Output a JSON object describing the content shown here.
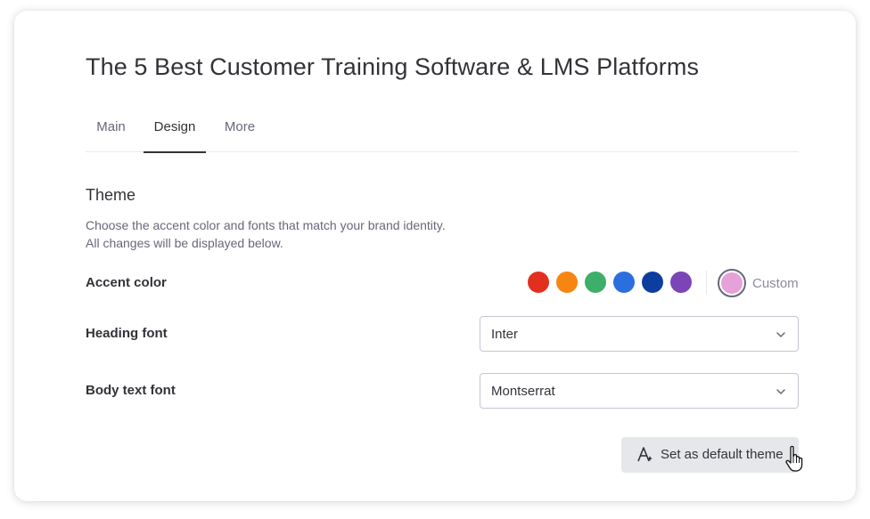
{
  "page": {
    "title": "The 5 Best Customer Training Software & LMS Platforms"
  },
  "tabs": [
    {
      "label": "Main",
      "active": false
    },
    {
      "label": "Design",
      "active": true
    },
    {
      "label": "More",
      "active": false
    }
  ],
  "theme": {
    "title": "Theme",
    "description_line1": "Choose the accent color and fonts that match your brand identity.",
    "description_line2": "All changes will be displayed below."
  },
  "accent": {
    "label": "Accent color",
    "swatches": [
      "#e2301f",
      "#f68512",
      "#3daf6a",
      "#2b6fde",
      "#0d3d9f",
      "#7b45b8"
    ],
    "custom_color": "#e6a1d8",
    "custom_label": "Custom",
    "selected": "custom"
  },
  "heading_font": {
    "label": "Heading font",
    "value": "Inter"
  },
  "body_font": {
    "label": "Body text font",
    "value": "Montserrat"
  },
  "actions": {
    "set_default_label": "Set as default theme"
  },
  "icons": {
    "chevron": "chevron-down-icon",
    "default_theme": "font-sparkle-icon",
    "cursor": "hand-pointer-icon"
  }
}
